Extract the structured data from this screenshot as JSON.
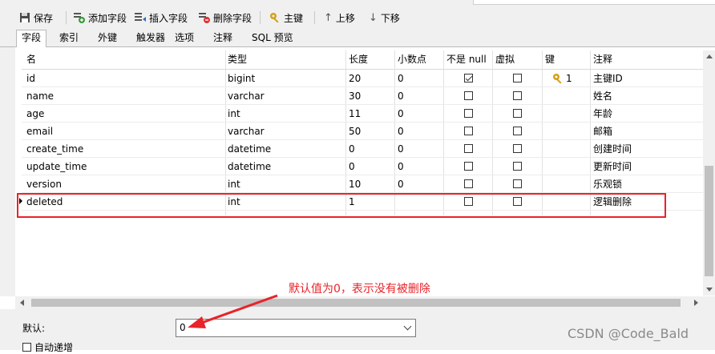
{
  "toolbar": {
    "save": "保存",
    "add_field": "添加字段",
    "insert_field": "插入字段",
    "delete_field": "删除字段",
    "primary_key": "主键",
    "move_up": "上移",
    "move_down": "下移"
  },
  "tabs": [
    "字段",
    "索引",
    "外键",
    "触发器",
    "选项",
    "注释",
    "SQL 预览"
  ],
  "columns": [
    "名",
    "类型",
    "长度",
    "小数点",
    "不是 null",
    "虚拟",
    "键",
    "注释"
  ],
  "rows": [
    {
      "name": "id",
      "type": "bigint",
      "length": "20",
      "decimals": "0",
      "not_null": true,
      "virtual": false,
      "key": "1",
      "comment": "主键ID"
    },
    {
      "name": "name",
      "type": "varchar",
      "length": "30",
      "decimals": "0",
      "not_null": false,
      "virtual": false,
      "key": "",
      "comment": "姓名"
    },
    {
      "name": "age",
      "type": "int",
      "length": "11",
      "decimals": "0",
      "not_null": false,
      "virtual": false,
      "key": "",
      "comment": "年龄"
    },
    {
      "name": "email",
      "type": "varchar",
      "length": "50",
      "decimals": "0",
      "not_null": false,
      "virtual": false,
      "key": "",
      "comment": "邮箱"
    },
    {
      "name": "create_time",
      "type": "datetime",
      "length": "0",
      "decimals": "0",
      "not_null": false,
      "virtual": false,
      "key": "",
      "comment": "创建时间"
    },
    {
      "name": "update_time",
      "type": "datetime",
      "length": "0",
      "decimals": "0",
      "not_null": false,
      "virtual": false,
      "key": "",
      "comment": "更新时间"
    },
    {
      "name": "version",
      "type": "int",
      "length": "10",
      "decimals": "0",
      "not_null": false,
      "virtual": false,
      "key": "",
      "comment": "乐观锁"
    },
    {
      "name": "deleted",
      "type": "int",
      "length": "1",
      "decimals": "",
      "not_null": false,
      "virtual": false,
      "key": "",
      "comment": "逻辑删除"
    }
  ],
  "bottom": {
    "default_label": "默认:",
    "default_value": "0",
    "auto_increment_label": "自动递增"
  },
  "annotation": "默认值为0，表示没有被删除",
  "watermark": "CSDN @Code_Bald",
  "colors": {
    "highlight_red": "#e8232a",
    "key_gold": "#d4a017"
  }
}
